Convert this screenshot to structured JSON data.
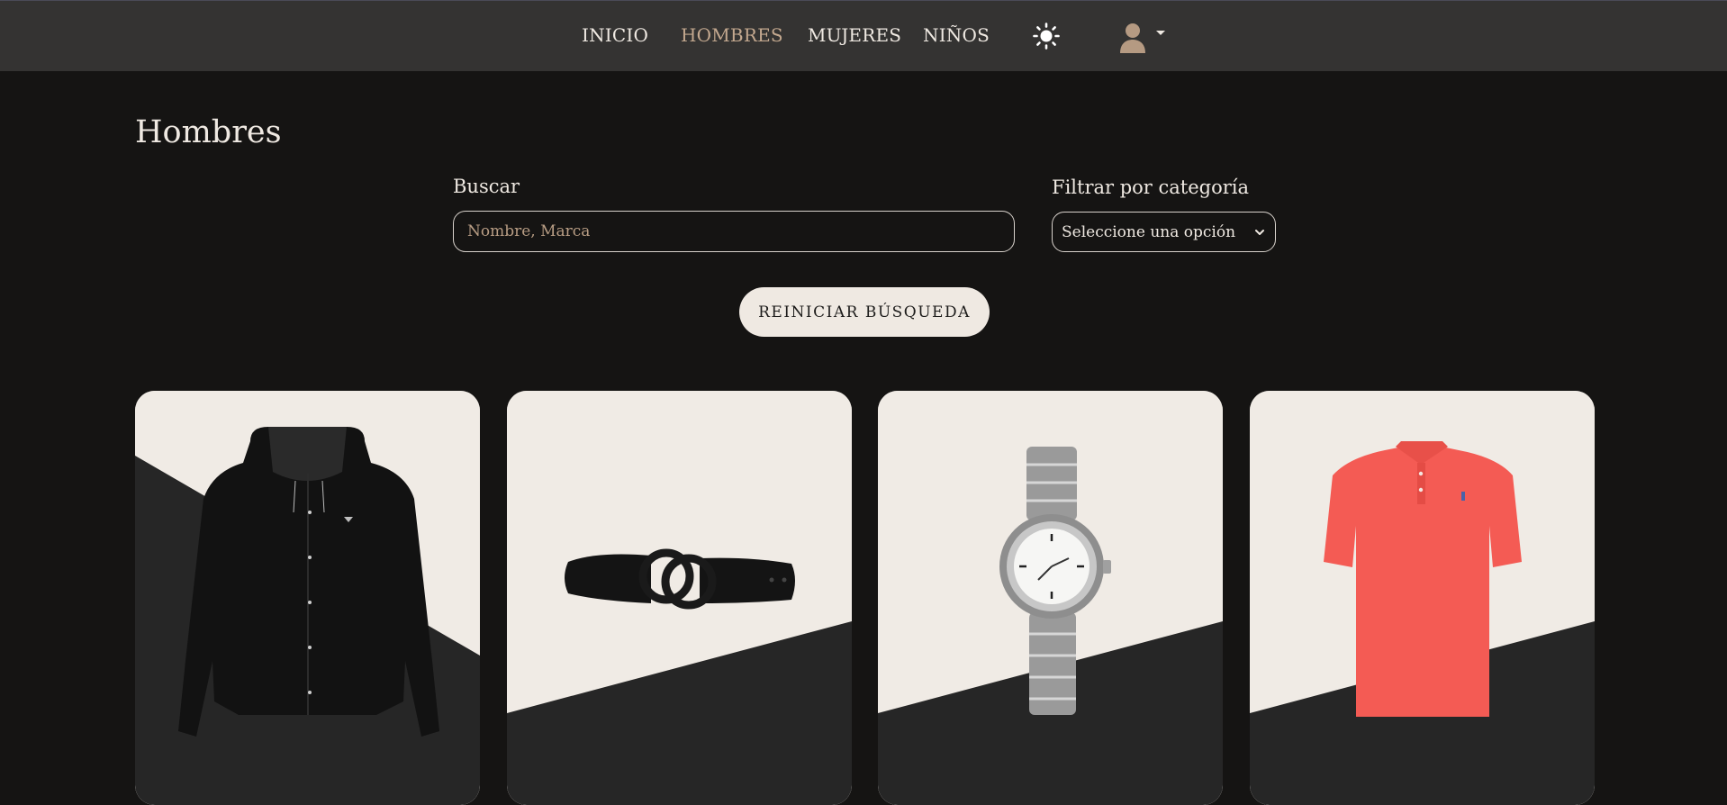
{
  "nav": {
    "links": [
      {
        "label": "INICIO",
        "active": false
      },
      {
        "label": "HOMBRES",
        "active": true
      },
      {
        "label": "MUJERES",
        "active": false
      },
      {
        "label": "NIÑOS",
        "active": false
      }
    ],
    "theme_icon": "sun-icon",
    "user_icon": "user-avatar-icon",
    "active_color": "#c3a88f"
  },
  "page": {
    "title": "Hombres"
  },
  "filters": {
    "search_label": "Buscar",
    "search_placeholder": "Nombre, Marca",
    "search_value": "",
    "category_label": "Filtrar por categoría",
    "category_selected": "Seleccione una opción",
    "reset_label": "REINICIAR BÚSQUEDA"
  },
  "products": [
    {
      "image": "black-hooded-jacket",
      "diagonal": "down"
    },
    {
      "image": "black-belt",
      "diagonal": "up"
    },
    {
      "image": "silver-watch",
      "diagonal": "up"
    },
    {
      "image": "red-polo-shirt",
      "diagonal": "up"
    }
  ],
  "colors": {
    "background": "#151413",
    "navbar": "#343332",
    "card_light": "#f0ebe5",
    "card_dark": "#262626",
    "text": "#efe9e2"
  }
}
